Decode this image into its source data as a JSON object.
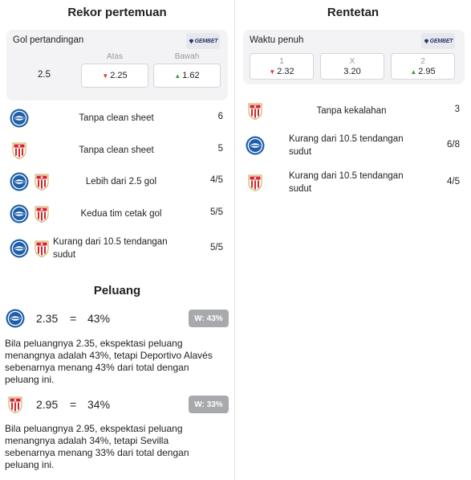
{
  "left": {
    "title": "Rekor pertemuan",
    "market": {
      "label": "Gol pertandingan",
      "bookmaker": "GEMBET",
      "line": "2.5",
      "over_header": "Atas",
      "under_header": "Bawah",
      "over_value": "2.25",
      "over_trend": "down",
      "under_value": "1.62",
      "under_trend": "up"
    },
    "stats": [
      {
        "teams": [
          "alaves"
        ],
        "text": "Tanpa clean sheet",
        "value": "6"
      },
      {
        "teams": [
          "sevilla"
        ],
        "text": "Tanpa clean sheet",
        "value": "5"
      },
      {
        "teams": [
          "alaves",
          "sevilla"
        ],
        "text": "Lebih dari 2.5 gol",
        "value": "4/5"
      },
      {
        "teams": [
          "alaves",
          "sevilla"
        ],
        "text": "Kedua tim cetak gol",
        "value": "5/5"
      },
      {
        "teams": [
          "alaves",
          "sevilla"
        ],
        "text_line1": "Kurang dari 10.5 tendangan",
        "text_line2": "sudut",
        "value": "5/5"
      }
    ],
    "chance_title": "Peluang",
    "chances": [
      {
        "team": "alaves",
        "odd": "2.35",
        "eq": "=",
        "pct": "43%",
        "w": "W: 43%",
        "desc_lines": [
          "Bila peluangnya 2.35, ekspektasi peluang",
          "menangnya adalah 43%, tetapi Deportivo Alavés",
          "sebenarnya menang 43% dari total dengan",
          "peluang ini."
        ]
      },
      {
        "team": "sevilla",
        "odd": "2.95",
        "eq": "=",
        "pct": "34%",
        "w": "W: 33%",
        "desc_lines": [
          "Bila peluangnya 2.95, ekspektasi peluang",
          "menangnya adalah 34%, tetapi Sevilla",
          "sebenarnya menang 33% dari total dengan",
          "peluang ini."
        ]
      }
    ]
  },
  "right": {
    "title": "Rentetan",
    "market": {
      "label": "Waktu penuh",
      "bookmaker": "GEMBET",
      "home_label": "1",
      "home_value": "2.32",
      "home_trend": "down",
      "draw_label": "X",
      "draw_value": "3.20",
      "away_label": "2",
      "away_value": "2.95",
      "away_trend": "up"
    },
    "stats": [
      {
        "teams": [
          "sevilla"
        ],
        "text": "Tanpa kekalahan",
        "value": "3"
      },
      {
        "teams": [
          "alaves"
        ],
        "text_line1": "Kurang dari 10.5 tendangan",
        "text_line2": "sudut",
        "value": "6/8"
      },
      {
        "teams": [
          "sevilla"
        ],
        "text_line1": "Kurang dari 10.5 tendangan",
        "text_line2": "sudut",
        "value": "4/5"
      }
    ]
  },
  "colors": {
    "down": "#d33333",
    "up": "#2a9d4a",
    "alaves": "#1f5fa8",
    "sevilla": "#d6242b"
  },
  "icons": {
    "down": "▼",
    "up": "▲"
  }
}
